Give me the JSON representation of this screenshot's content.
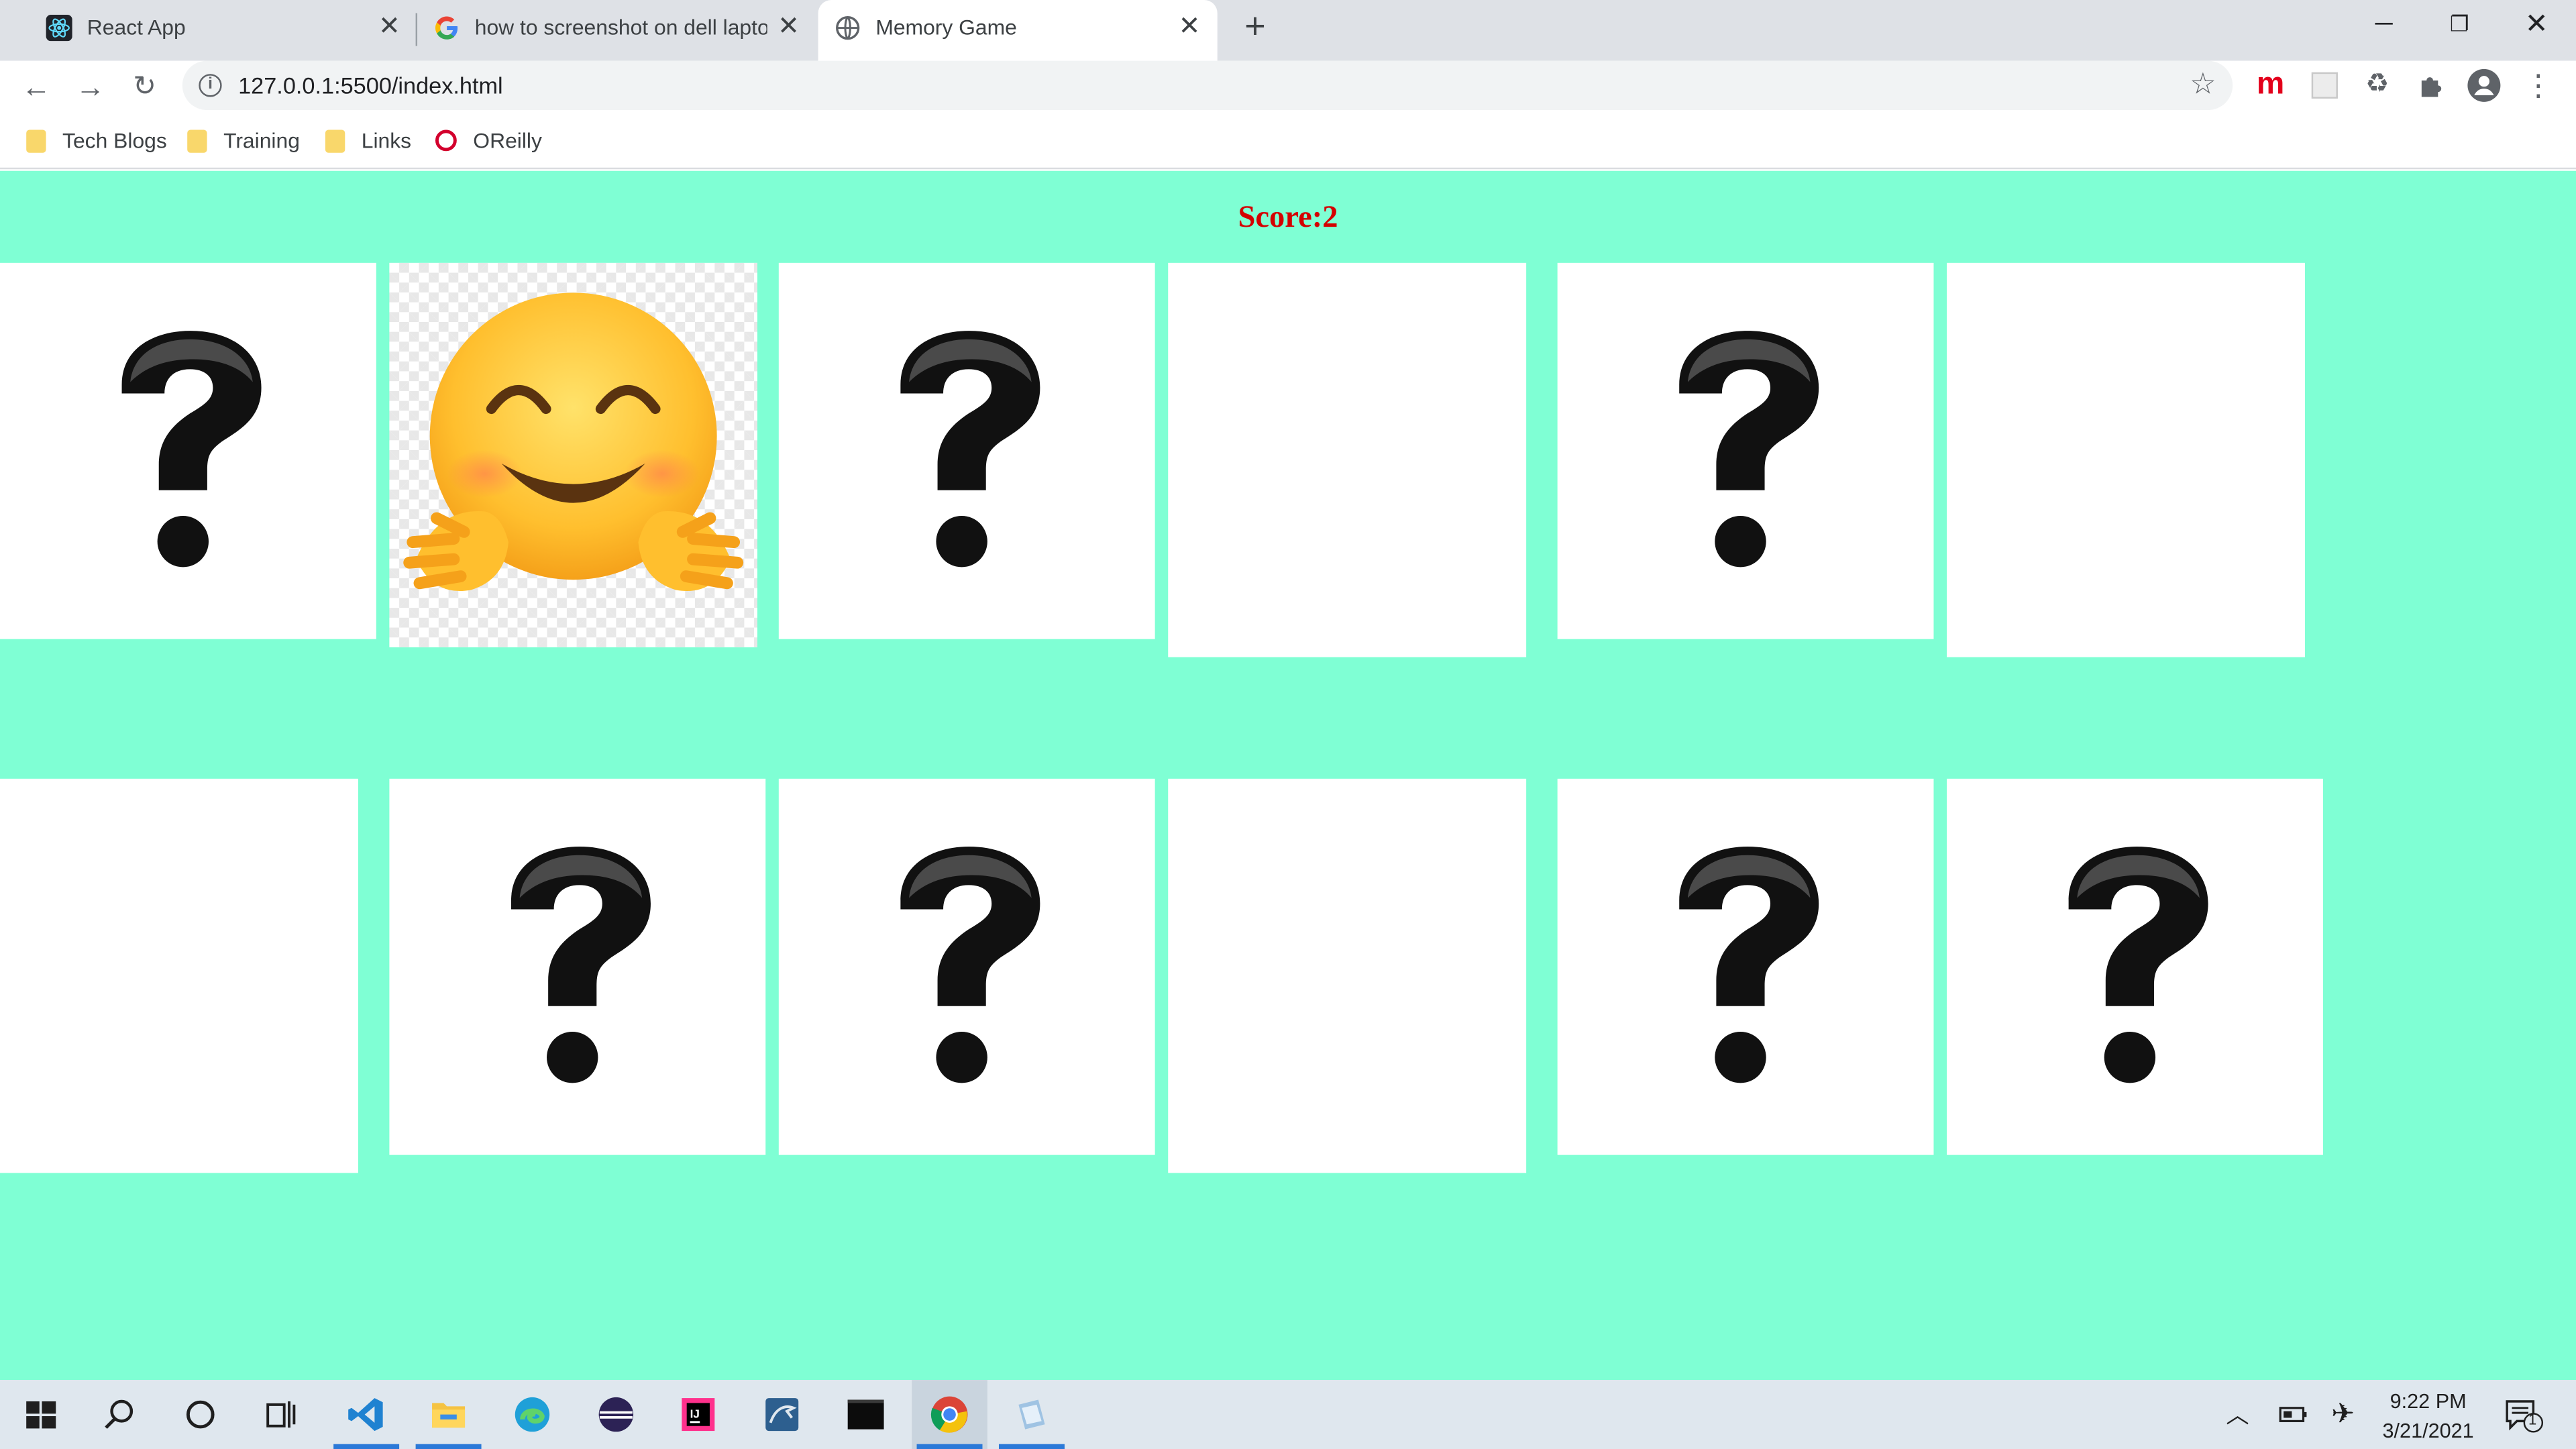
{
  "browser": {
    "tabs": [
      {
        "title": "React App",
        "icon": "react-icon",
        "active": false
      },
      {
        "title": "how to screenshot on dell laptop",
        "icon": "google-icon",
        "active": false
      },
      {
        "title": "Memory Game",
        "icon": "globe-icon",
        "active": true
      }
    ],
    "address": "127.0.0.1:5500/index.html",
    "bookmarks": [
      {
        "label": "Tech Blogs",
        "icon": "folder-icon"
      },
      {
        "label": "Training",
        "icon": "folder-icon"
      },
      {
        "label": "Links",
        "icon": "folder-icon"
      },
      {
        "label": "OReilly",
        "icon": "oreilly-icon"
      }
    ],
    "extension_m_label": "m"
  },
  "game": {
    "score_label": "Score:",
    "score_value": "2",
    "background_color": "#7fffd4",
    "score_color": "#d40000",
    "rows": [
      [
        "question",
        "emoji-hugging",
        "question",
        "blank",
        "question",
        "blank"
      ],
      [
        "blank",
        "question",
        "question",
        "blank",
        "question",
        "question"
      ]
    ]
  },
  "taskbar": {
    "apps": [
      "windows-start-icon",
      "search-icon",
      "cortana-icon",
      "task-view-icon",
      "vscode-icon",
      "file-explorer-icon",
      "edge-icon",
      "eclipse-icon",
      "intellij-icon",
      "mysql-workbench-icon",
      "terminal-icon",
      "chrome-icon",
      "snipping-tool-icon"
    ],
    "time": "9:22 PM",
    "date": "3/21/2021",
    "notification_count": "1"
  }
}
